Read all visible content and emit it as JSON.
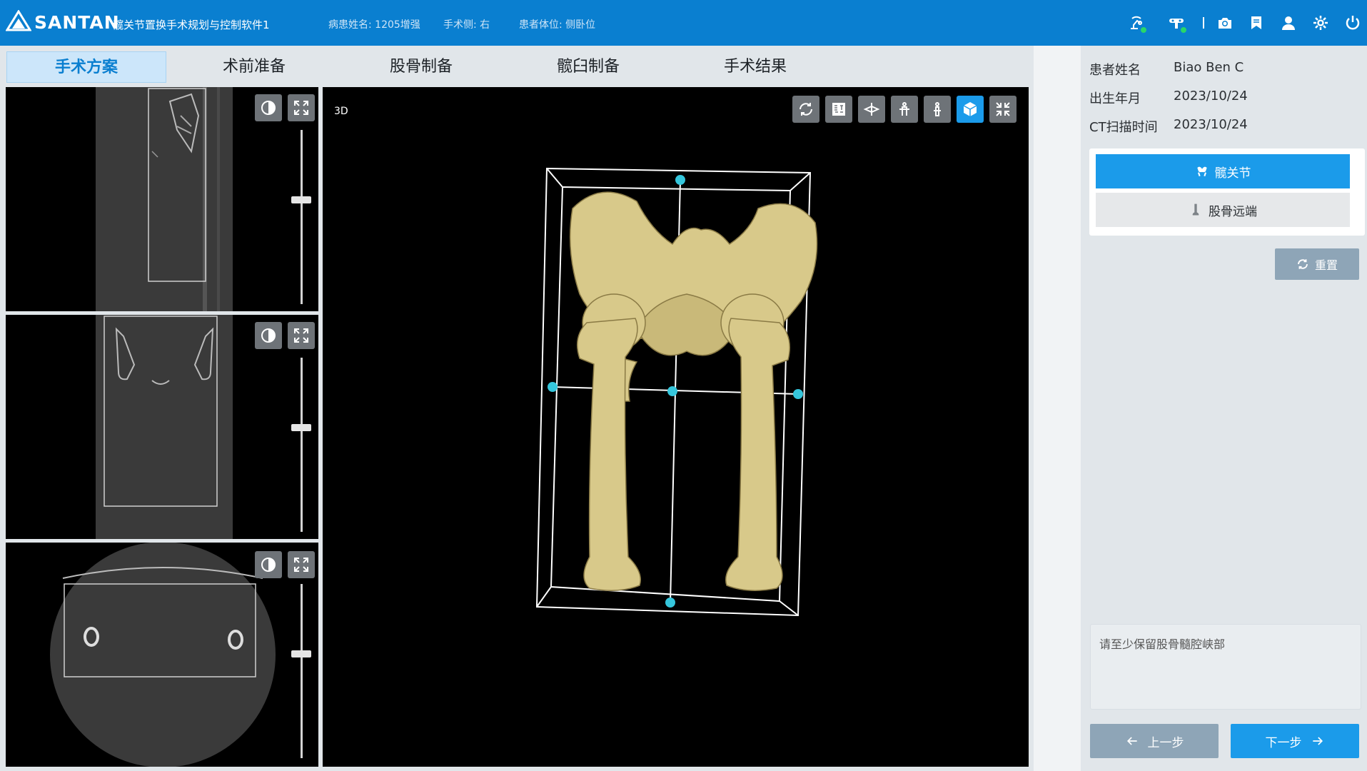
{
  "header": {
    "brand": "SANTAN",
    "app_title": "髋关节置换手术规划与控制软件1",
    "patient_name": "病患姓名: 1205增强",
    "surgery_side": "手术侧: 右",
    "patient_position": "患者体位: 侧卧位",
    "icons": [
      "robot-arm-icon",
      "navigation-camera-icon",
      "screenshot-icon",
      "bookmark-icon",
      "user-icon",
      "settings-icon",
      "power-icon"
    ],
    "status_color": "#28d66a",
    "bar_color": "#0a7fd0"
  },
  "tabs": [
    {
      "label": "手术方案",
      "active": true
    },
    {
      "label": "术前准备",
      "active": false
    },
    {
      "label": "股骨制备",
      "active": false
    },
    {
      "label": "髋臼制备",
      "active": false
    },
    {
      "label": "手术结果",
      "active": false
    }
  ],
  "views": {
    "slice_controls": [
      "contrast-icon",
      "maximize-icon"
    ],
    "sliders": [
      0.38,
      0.38,
      0.38
    ],
    "label_3d": "3D",
    "toolbar_3d": [
      "rotate-icon",
      "3d-ct-icon",
      "axial-view-icon",
      "coronal-view-icon",
      "sagittal-view-icon",
      "cube-view-icon",
      "collapse-icon"
    ]
  },
  "patient": {
    "name_label": "患者姓名",
    "name_value": "Biao Ben C",
    "dob_label": "出生年月",
    "dob_value": "2023/10/24",
    "ct_label": "CT扫描时间",
    "ct_value": "2023/10/24"
  },
  "region": {
    "hip_label": "髋关节",
    "distal_label": "股骨远端"
  },
  "reset_label": "重置",
  "message": "请至少保留股骨髓腔峡部",
  "nav": {
    "prev_label": "上一步",
    "next_label": "下一步"
  },
  "colors": {
    "accent": "#1b9bea",
    "bone": "#d8c98a",
    "handle": "#35c6dc"
  }
}
